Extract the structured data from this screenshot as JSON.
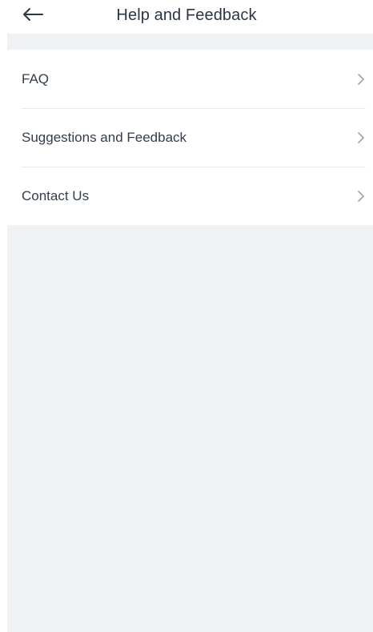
{
  "header": {
    "title": "Help and Feedback",
    "back_icon": "arrow-left-icon"
  },
  "menu": {
    "items": [
      {
        "label": "FAQ",
        "icon": "chevron-right-icon"
      },
      {
        "label": "Suggestions and Feedback",
        "icon": "chevron-right-icon"
      },
      {
        "label": "Contact Us",
        "icon": "chevron-right-icon"
      }
    ]
  },
  "colors": {
    "background": "#eef2f5",
    "surface": "#ffffff",
    "text": "#333e4c",
    "divider": "#e6e9ed",
    "chevron": "#9aa3ad"
  }
}
